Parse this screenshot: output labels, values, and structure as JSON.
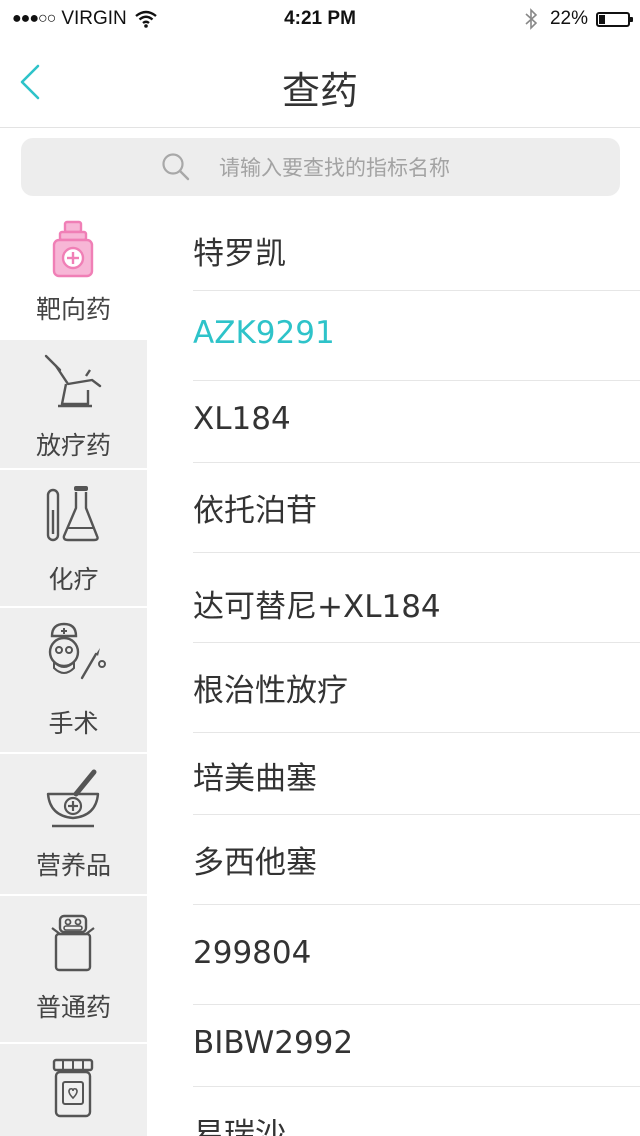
{
  "status_bar": {
    "signal_dots": "●●●○○",
    "carrier": "VIRGIN",
    "time": "4:21 PM",
    "battery": "22%",
    "battery_level": 0.22
  },
  "nav": {
    "title": "查药"
  },
  "search": {
    "placeholder": "请输入要查找的指标名称"
  },
  "categories": [
    {
      "label": "靶向药",
      "icon": "medicine-bottle-icon",
      "active": true
    },
    {
      "label": "放疗药",
      "icon": "radiotherapy-chair-icon",
      "active": false
    },
    {
      "label": "化疗",
      "icon": "lab-flask-icon",
      "active": false
    },
    {
      "label": "手术",
      "icon": "surgeon-icon",
      "active": false
    },
    {
      "label": "营养品",
      "icon": "mortar-icon",
      "active": false
    },
    {
      "label": "普通药",
      "icon": "pill-jar-icon",
      "active": false
    },
    {
      "label": "",
      "icon": "pill-box-icon",
      "active": false
    }
  ],
  "drugs": [
    {
      "name": "特罗凯",
      "active": false
    },
    {
      "name": "AZK9291",
      "active": true
    },
    {
      "name": "XL184",
      "active": false
    },
    {
      "name": "依托泊苷",
      "active": false
    },
    {
      "name": "达可替尼+XL184",
      "active": false
    },
    {
      "name": "根治性放疗",
      "active": false
    },
    {
      "name": "培美曲塞",
      "active": false
    },
    {
      "name": "多西他塞",
      "active": false
    },
    {
      "name": "299804",
      "active": false
    },
    {
      "name": "BIBW2992",
      "active": false
    },
    {
      "name": "易瑞沙",
      "active": false
    }
  ],
  "colors": {
    "accent": "#2ec3c9",
    "active_icon": "#f07fb6"
  }
}
